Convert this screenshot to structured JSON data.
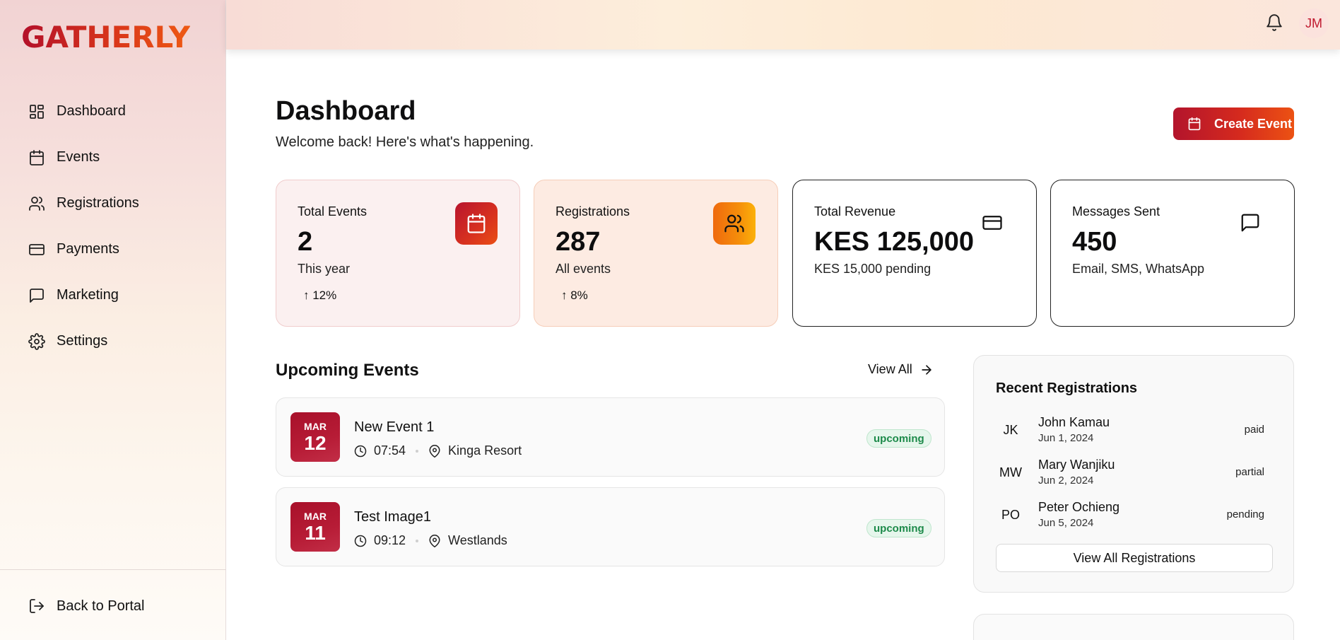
{
  "brand": {
    "logo_text": "GATHERLY"
  },
  "sidebar": {
    "items": [
      {
        "label": "Dashboard",
        "icon": "layout-dashboard-icon"
      },
      {
        "label": "Events",
        "icon": "calendar-icon"
      },
      {
        "label": "Registrations",
        "icon": "users-icon"
      },
      {
        "label": "Payments",
        "icon": "credit-card-icon"
      },
      {
        "label": "Marketing",
        "icon": "message-square-icon"
      },
      {
        "label": "Settings",
        "icon": "gear-icon"
      }
    ],
    "back_label": "Back to Portal"
  },
  "topbar": {
    "user_initials": "JM"
  },
  "header": {
    "title": "Dashboard",
    "subtitle": "Welcome back! Here's what's happening.",
    "create_label": "Create Event"
  },
  "stats": [
    {
      "label": "Total Events",
      "value": "2",
      "sub": "This year",
      "trend": "↑ 12%",
      "icon": "calendar-icon"
    },
    {
      "label": "Registrations",
      "value": "287",
      "sub": "All events",
      "trend": "↑ 8%",
      "icon": "users-icon"
    },
    {
      "label": "Total Revenue",
      "value": "KES 125,000",
      "sub": "KES 15,000 pending",
      "icon": "credit-card-icon"
    },
    {
      "label": "Messages Sent",
      "value": "450",
      "sub": "Email, SMS, WhatsApp",
      "icon": "message-square-icon"
    }
  ],
  "upcoming": {
    "title": "Upcoming Events",
    "view_all": "View All",
    "events": [
      {
        "month": "MAR",
        "day": "12",
        "name": "New Event 1",
        "time": "07:54",
        "location": "Kinga Resort",
        "status": "upcoming"
      },
      {
        "month": "MAR",
        "day": "11",
        "name": "Test Image1",
        "time": "09:12",
        "location": "Westlands",
        "status": "upcoming"
      }
    ]
  },
  "recent": {
    "title": "Recent Registrations",
    "rows": [
      {
        "initials": "JK",
        "name": "John Kamau",
        "date": "Jun 1, 2024",
        "status": "paid"
      },
      {
        "initials": "MW",
        "name": "Mary Wanjiku",
        "date": "Jun 2, 2024",
        "status": "partial"
      },
      {
        "initials": "PO",
        "name": "Peter Ochieng",
        "date": "Jun 5, 2024",
        "status": "pending"
      }
    ],
    "view_all": "View All Registrations"
  },
  "colors": {
    "brand_red": "#b3102a",
    "brand_orange": "#ee5a14",
    "status_green": "#1d8a4a"
  }
}
